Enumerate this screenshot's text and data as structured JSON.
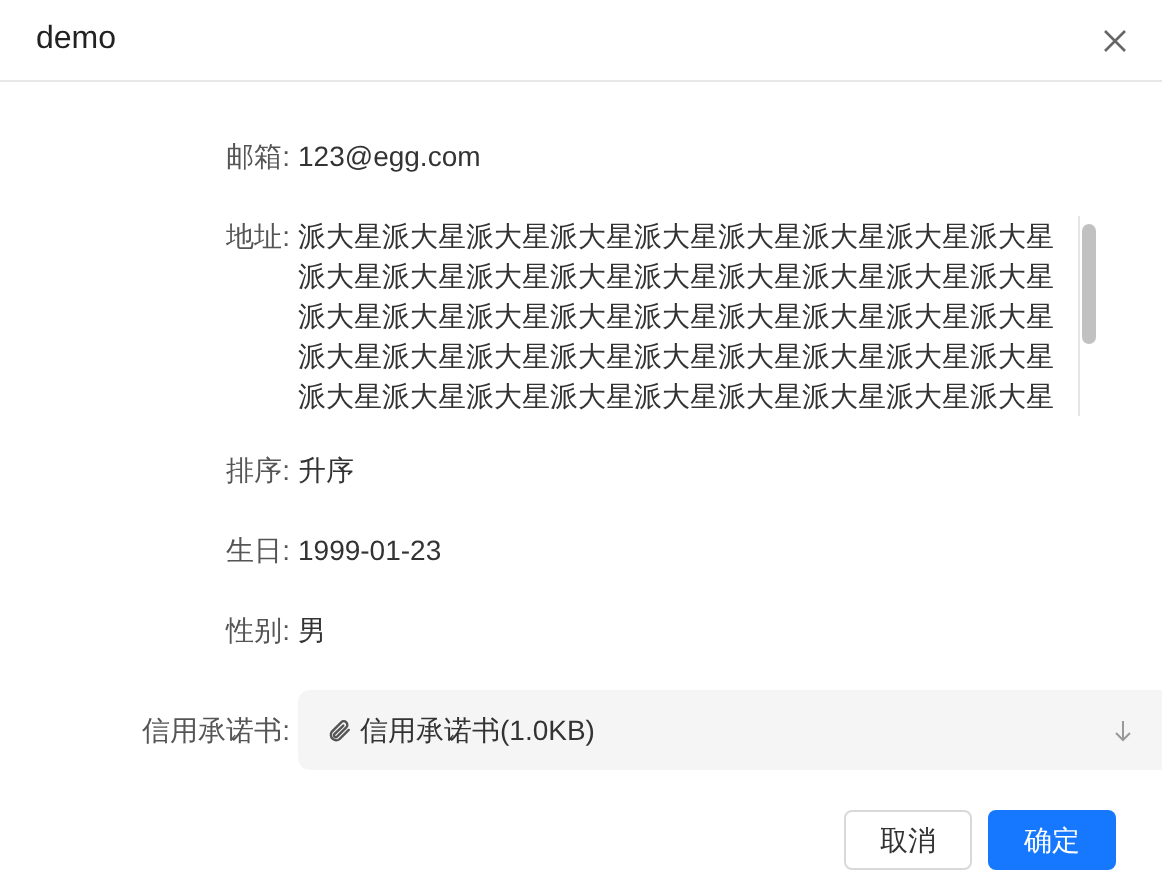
{
  "dialog": {
    "title": "demo"
  },
  "fields": [
    {
      "kind": "text",
      "label": "邮箱:",
      "value": "123@egg.com"
    },
    {
      "kind": "multiline",
      "label": "地址:",
      "lines": [
        "派大星派大星派大星派大星派大星派大星派大星派大星派大星",
        "派大星派大星派大星派大星派大星派大星派大星派大星派大星",
        "派大星派大星派大星派大星派大星派大星派大星派大星派大星",
        "派大星派大星派大星派大星派大星派大星派大星派大星派大星",
        "派大星派大星派大星派大星派大星派大星派大星派大星派大星"
      ]
    },
    {
      "kind": "text",
      "label": "排序:",
      "value": "升序"
    },
    {
      "kind": "text",
      "label": "生日:",
      "value": "1999-01-23"
    },
    {
      "kind": "text",
      "label": "性别:",
      "value": "男"
    },
    {
      "kind": "file",
      "label": "信用承诺书:",
      "value": "信用承诺书(1.0KB)"
    }
  ],
  "buttons": [
    {
      "label": "取消",
      "kind": "default"
    },
    {
      "label": "确定",
      "kind": "primary"
    }
  ]
}
